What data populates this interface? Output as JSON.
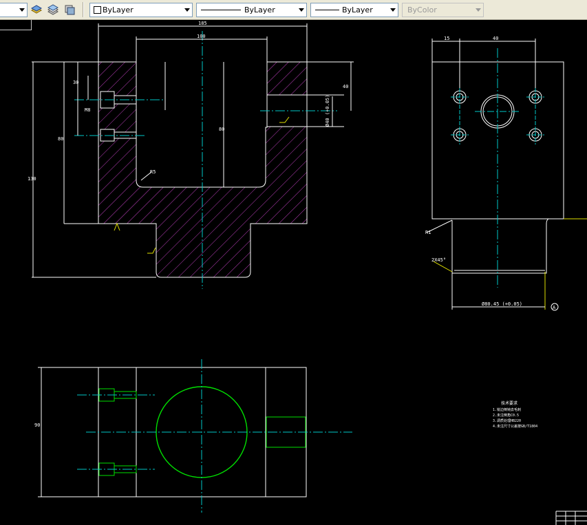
{
  "toolbar": {
    "color_combo": "ByLayer",
    "linetype_combo": "ByLayer",
    "lineweight_combo": "ByLayer",
    "plotstyle_combo": "ByColor"
  },
  "drawing": {
    "colors": {
      "background": "#000000",
      "outline": "#ffffff",
      "center_line": "#00c8c8",
      "hatch": "#c040c0",
      "circle": "#00e000",
      "leader": "#e0e000"
    },
    "dim_labels": {
      "top_overall": "185",
      "slot_width": "100",
      "left_overall_height": "130",
      "inner_height": "80",
      "slot_depth": "80",
      "bolt_spacing": "30",
      "bolt_size": "M8",
      "fillet_radius": "R5",
      "side_tol_right": "40",
      "side_tol_label": "Ø40 (+0.05)",
      "right_flange_width": "15",
      "right_bore_spacing": "40",
      "right_base_dim": "Ø80.45 (+0.05)",
      "right_radius": "R1",
      "chamfer": "2X45°",
      "datum": "A",
      "bottom_view_height": "90"
    },
    "notes": {
      "title": "技术要求",
      "lines": [
        "1.锐边倒钝去毛刺",
        "2.未注倒角C0.5",
        "3.调质处理HB220",
        "4.未注尺寸公差按GB/T1804"
      ]
    }
  }
}
